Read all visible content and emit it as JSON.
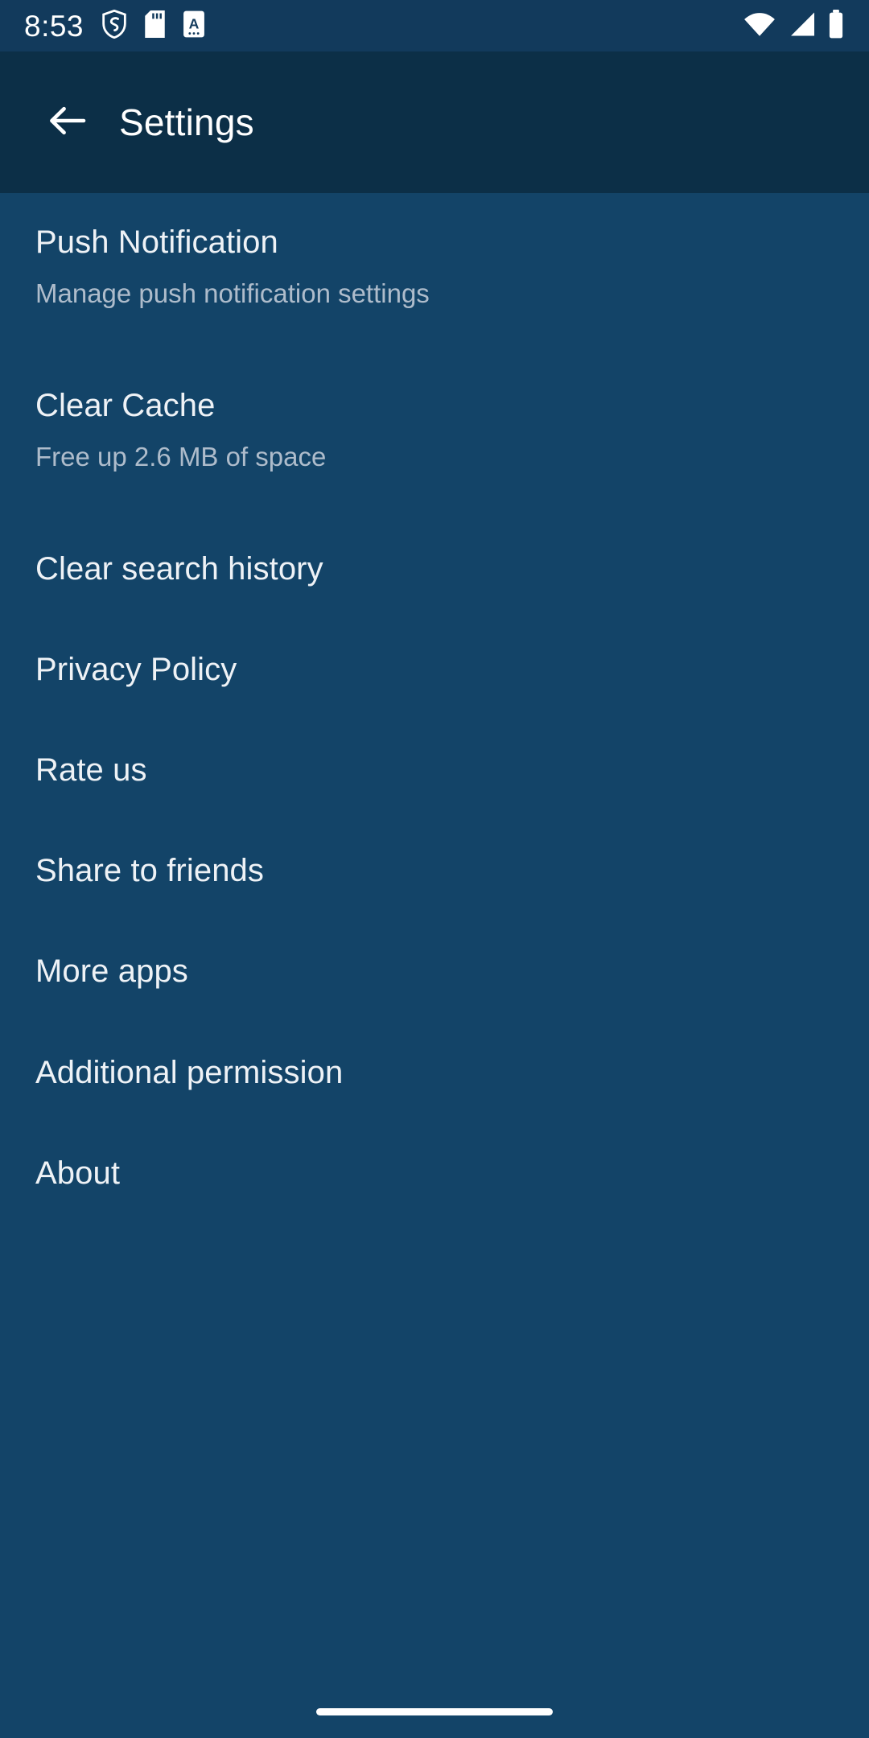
{
  "status_bar": {
    "time": "8:53",
    "left_icons": [
      "shield-icon",
      "sd-card-icon",
      "text-document-icon"
    ],
    "right_icons": [
      "wifi-icon",
      "cellular-signal-icon",
      "battery-icon"
    ],
    "background_color": "#123a5c",
    "icon_color": "#ffffff"
  },
  "app_bar": {
    "back_icon": "arrow-left-icon",
    "title": "Settings",
    "background_color": "#0c2f47",
    "title_color": "#ffffff"
  },
  "theme": {
    "body_background": "#134468",
    "primary_text": "#eef2f6",
    "secondary_text": "#aebccb",
    "accent": "#134468"
  },
  "settings_list": [
    {
      "title": "Push Notification",
      "subtitle": "Manage push notification settings"
    },
    {
      "title": "Clear Cache",
      "subtitle": "Free up 2.6 MB of space"
    },
    {
      "title": "Clear search history",
      "subtitle": null
    },
    {
      "title": "Privacy Policy",
      "subtitle": null
    },
    {
      "title": "Rate us",
      "subtitle": null
    },
    {
      "title": "Share to friends",
      "subtitle": null
    },
    {
      "title": "More apps",
      "subtitle": null
    },
    {
      "title": "Additional permission",
      "subtitle": null
    },
    {
      "title": "About",
      "subtitle": null
    }
  ],
  "nav_bar": {
    "gesture_handle": "home-gesture-pill",
    "handle_color": "#ffffff"
  }
}
